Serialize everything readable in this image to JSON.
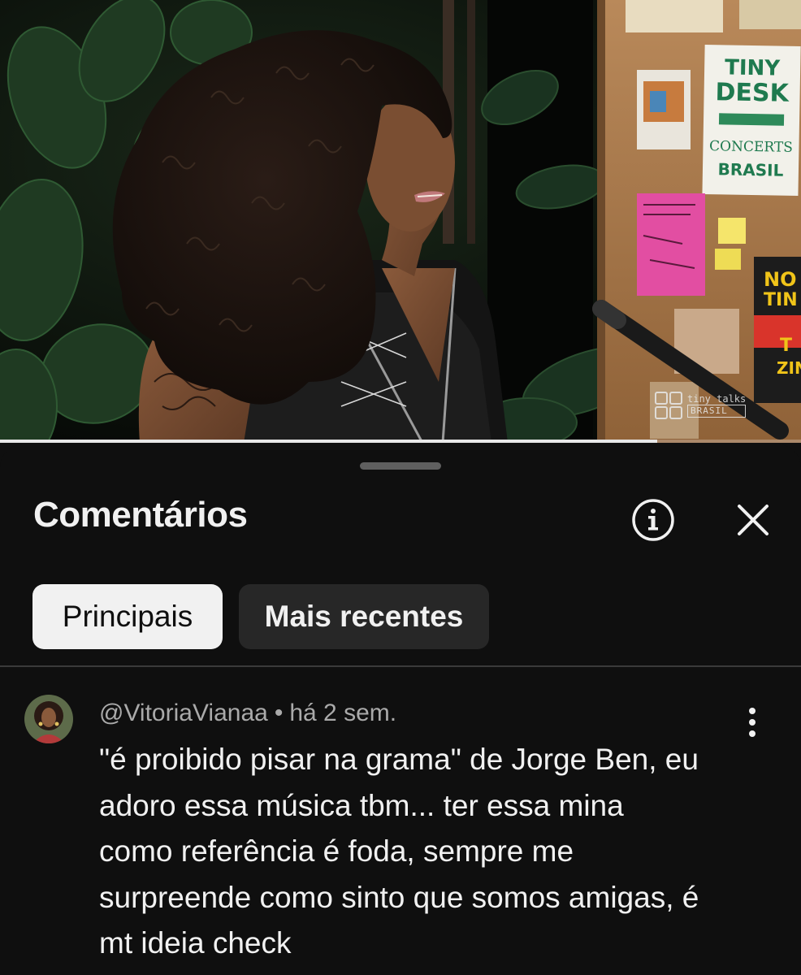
{
  "video": {
    "watermark_line1": "tiny talks",
    "watermark_line2": "BRASIL",
    "poster_title_lines": [
      "TINY",
      "DESK",
      "CONCERTS",
      "BRASIL"
    ],
    "poster2_lines": [
      "NO",
      "TIN",
      "T",
      "ZIN"
    ],
    "progress_fraction": 0.82
  },
  "sheet": {
    "title": "Comentários",
    "info_icon": "info-circle-icon",
    "close_icon": "close-icon",
    "chips": [
      {
        "label": "Principais",
        "selected": true
      },
      {
        "label": "Mais recentes",
        "selected": false
      }
    ]
  },
  "comment": {
    "author": "@VitoriaVianaa",
    "separator": "•",
    "time": "há 2 sem.",
    "text": "\"é proibido pisar na grama\" de Jorge Ben, eu\nadoro essa música tbm... ter essa mina\ncomo referência é foda, sempre me\nsurpreende como sinto que somos amigas, é\nmt ideia check",
    "more_icon": "more-vert-icon"
  },
  "colors": {
    "background": "#0f0f0f",
    "chip_active_bg": "#f1f1f1",
    "chip_inactive_bg": "#272727",
    "meta_text": "#aaaaaa",
    "primary_text": "#f1f1f1"
  }
}
